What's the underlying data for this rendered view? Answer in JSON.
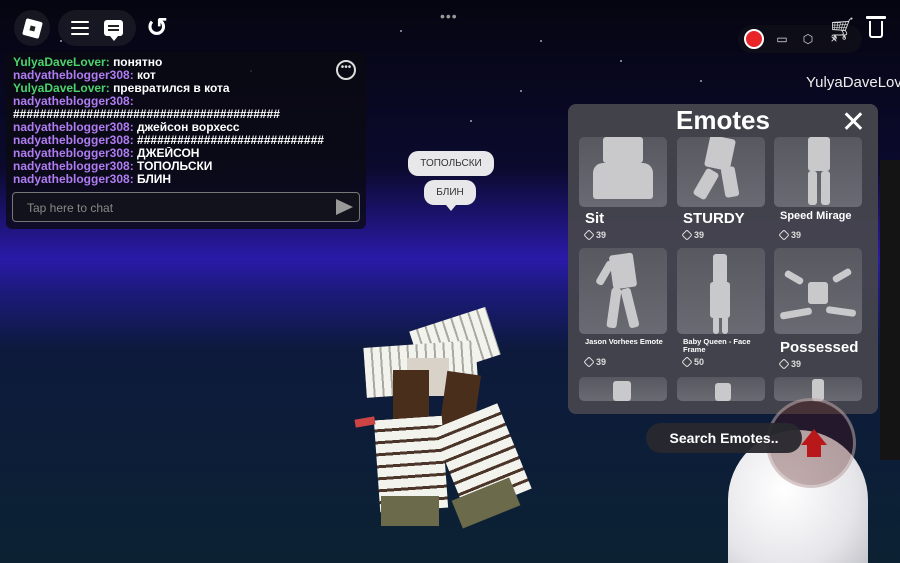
{
  "topbar": {
    "roblox_menu": "roblox-logo",
    "undo_glyph": "↺"
  },
  "recorder": {
    "folder_icon": "folder-icon",
    "settings_icon": "settings-icon",
    "close_glyph": "×"
  },
  "player": {
    "username": "YulyaDaveLover"
  },
  "chat": {
    "messages": [
      {
        "name": "YulyaDaveLover:",
        "text": "понятно",
        "color": "#4bd36b"
      },
      {
        "name": "nadyatheblogger308:",
        "text": "кот",
        "color": "#b07cf2"
      },
      {
        "name": "YulyaDaveLover:",
        "text": "превратился в кота",
        "color": "#4bd36b"
      },
      {
        "name": "nadyatheblogger308:",
        "text": "",
        "color": "#b07cf2"
      },
      {
        "name": "",
        "text": "########################################",
        "color": "#ffffff"
      },
      {
        "name": "nadyatheblogger308:",
        "text": "джейсон ворхесс",
        "color": "#b07cf2"
      },
      {
        "name": "nadyatheblogger308:",
        "text": "############################",
        "color": "#b07cf2"
      },
      {
        "name": "nadyatheblogger308:",
        "text": "ДЖЕЙСОН",
        "color": "#b07cf2"
      },
      {
        "name": "nadyatheblogger308:",
        "text": "ТОПОЛЬСКИ",
        "color": "#b07cf2"
      },
      {
        "name": "nadyatheblogger308:",
        "text": "БЛИН",
        "color": "#b07cf2"
      }
    ],
    "input_placeholder": "Tap here to chat"
  },
  "bubbles": [
    "ТОПОЛЬСКИ",
    "БЛИН"
  ],
  "emotes": {
    "title": "Emotes",
    "close": "✕",
    "items": [
      {
        "name": "Sit",
        "price": "39",
        "size": "big"
      },
      {
        "name": "STURDY",
        "price": "39",
        "size": "big"
      },
      {
        "name": "Speed Mirage",
        "price": "39",
        "size": "mid"
      },
      {
        "name": "Jason Vorhees Emote",
        "price": "39",
        "size": "sm"
      },
      {
        "name": "Baby Queen - Face Frame",
        "price": "50",
        "size": "sm"
      },
      {
        "name": "Possessed",
        "price": "39",
        "size": "big"
      }
    ],
    "search_label": "Search Emotes.."
  },
  "colors": {
    "record": "#e8262a",
    "sky_glow": "#2a1aa8",
    "panel": "#44444c"
  }
}
